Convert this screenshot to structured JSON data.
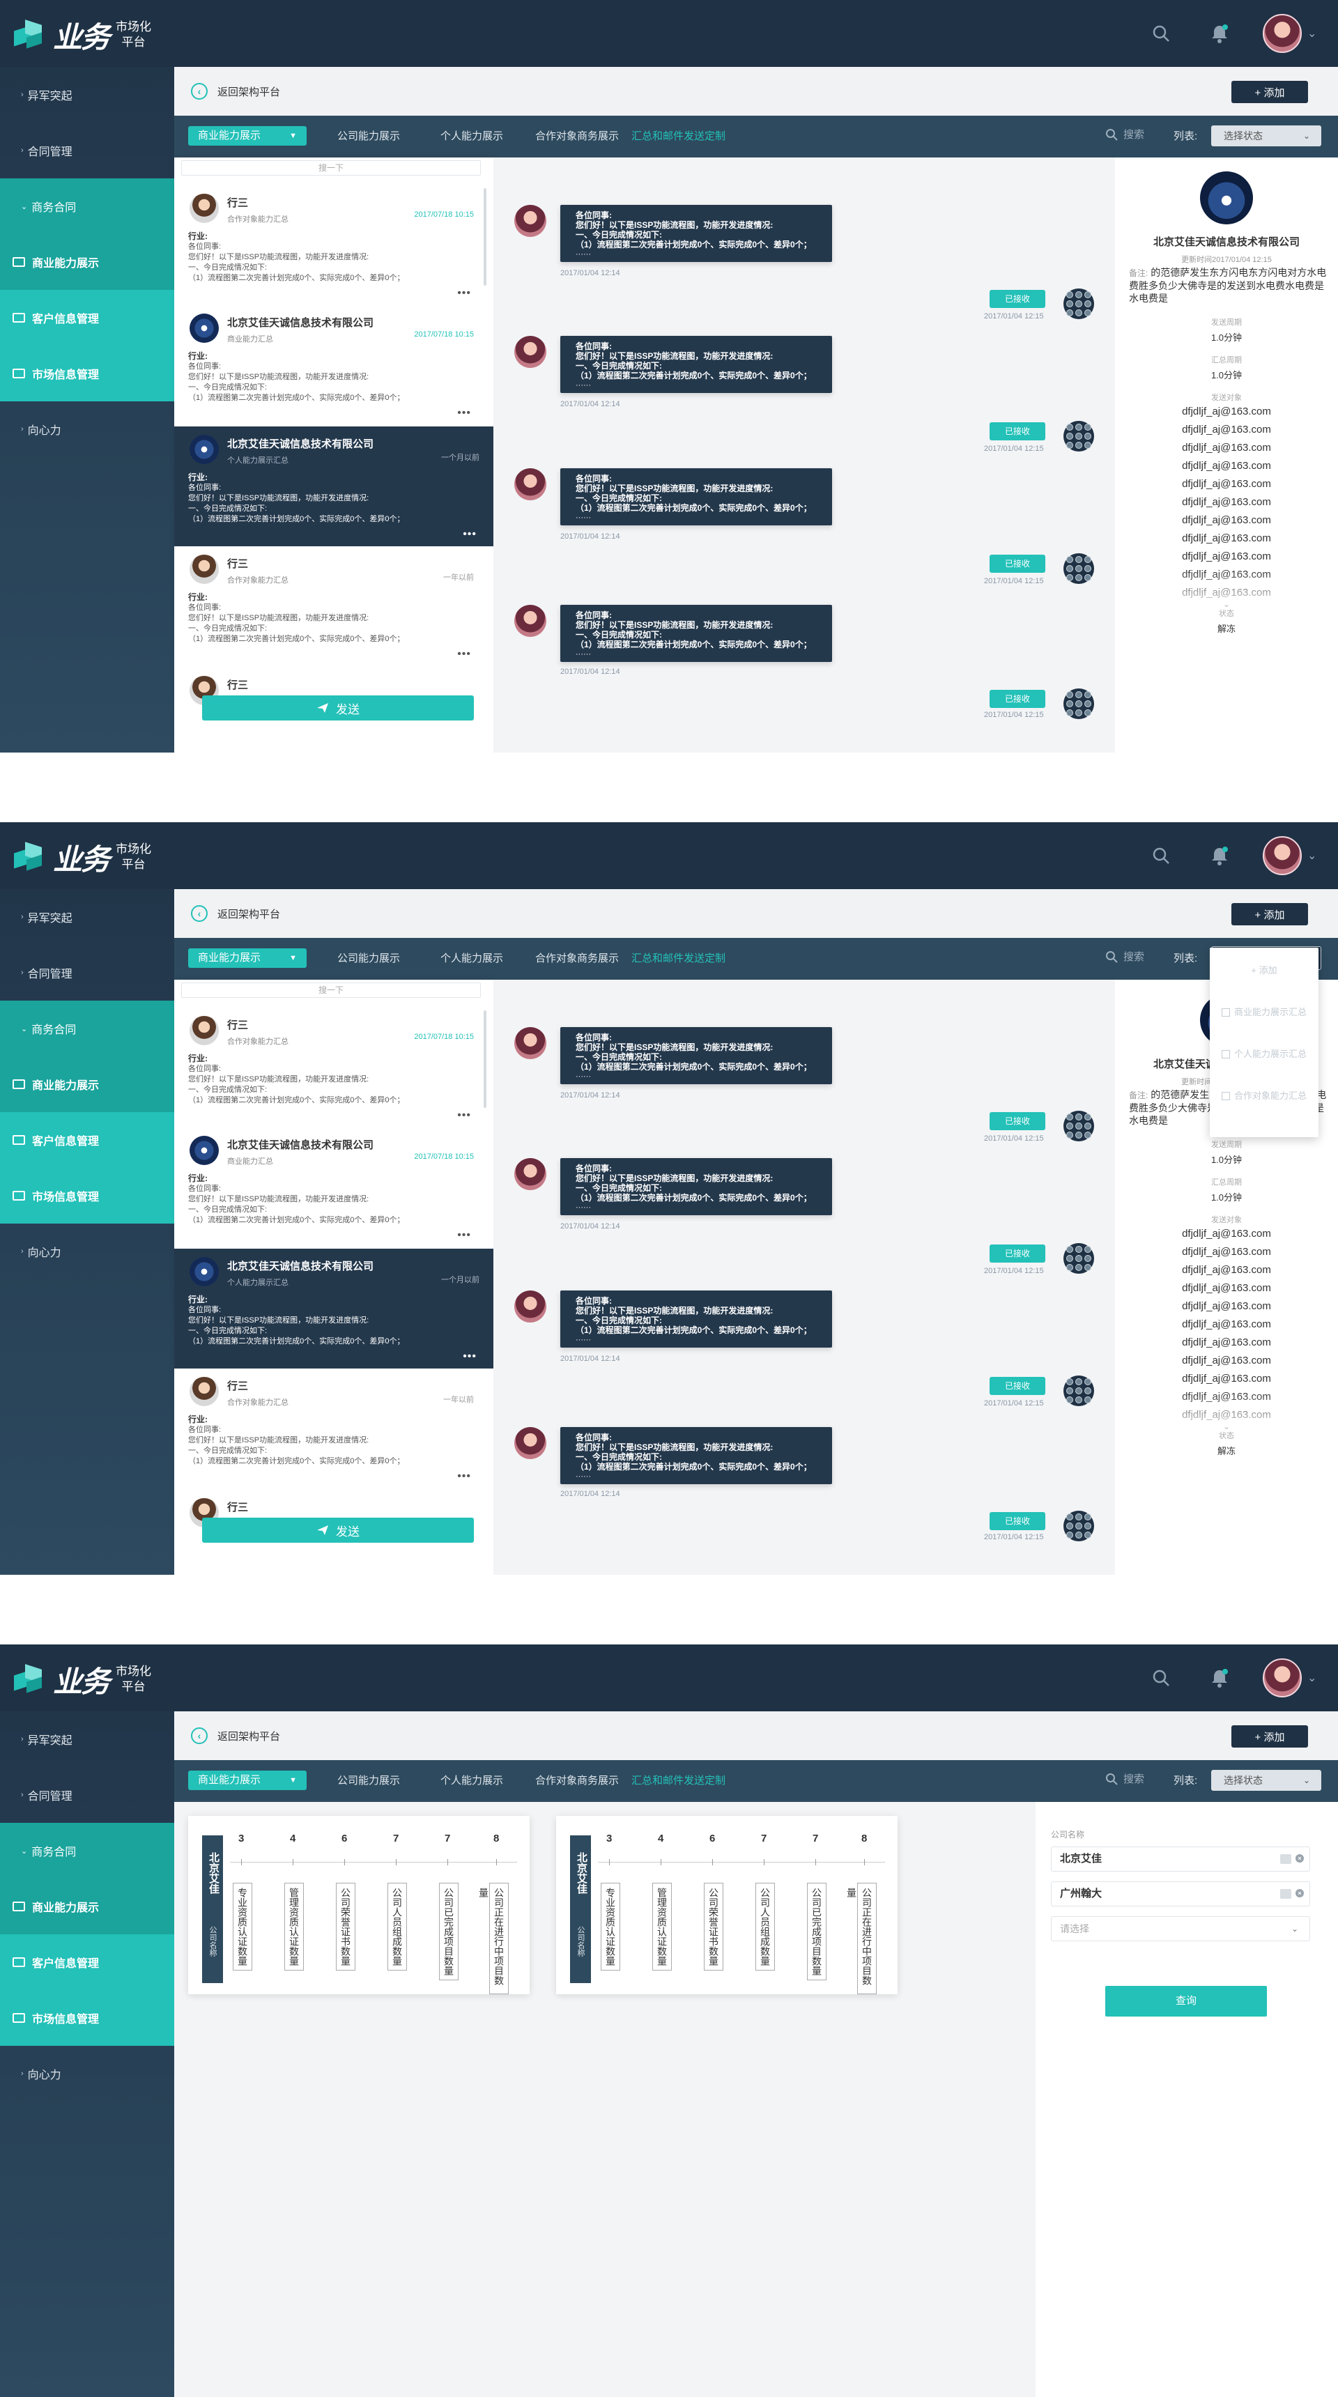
{
  "app": {
    "logo_main": "业务",
    "logo_sub_1": "市场化",
    "logo_sub_2": "平台"
  },
  "topbar": {
    "search_icon": "search-icon",
    "bell_icon": "bell-icon",
    "avatar_caret": "⌄"
  },
  "sidebar": {
    "items": [
      {
        "label": "异军突起"
      },
      {
        "label": "合同管理"
      },
      {
        "label": "商务合同"
      },
      {
        "label": "商业能力展示"
      },
      {
        "label": "客户信息管理"
      },
      {
        "label": "市场信息管理"
      },
      {
        "label": "向心力"
      }
    ]
  },
  "header": {
    "back_label": "返回架构平台",
    "add_label": "+ 添加"
  },
  "tabs": {
    "selected": "商业能力展示",
    "items": [
      "公司能力展示",
      "个人能力展示",
      "合作对象商务展示",
      "汇总和邮件发送定制"
    ],
    "search_label": "搜索",
    "list_label": "列表:",
    "select_label": "选择状态"
  },
  "list": {
    "search_placeholder": "搜一下",
    "send_label": "发送",
    "more": "•••",
    "cards": [
      {
        "name": "行三",
        "sub": "合作对象能力汇总",
        "time": "2017/07/18 10:15",
        "l1": "行业:",
        "l2": "各位同事:",
        "l3": "您们好！以下是ISSP功能流程图，功能开发进度情况:",
        "l4": "一、今日完成情况如下:",
        "l5": "（1）流程图第二次完善计划完成0个、实际完成0个、差异0个；"
      },
      {
        "name": "北京艾佳天诚信息技术有限公司",
        "sub": "商业能力汇总",
        "time": "2017/07/18 10:15",
        "l1": "行业:",
        "l2": "各位同事:",
        "l3": "您们好！以下是ISSP功能流程图，功能开发进度情况:",
        "l4": "一、今日完成情况如下:",
        "l5": "（1）流程图第二次完善计划完成0个、实际完成0个、差异0个；"
      },
      {
        "name": "北京艾佳天诚信息技术有限公司",
        "sub": "个人能力展示汇总",
        "time": "一个月以前",
        "l1": "行业:",
        "l2": "各位同事:",
        "l3": "您们好！以下是ISSP功能流程图，功能开发进度情况:",
        "l4": "一、今日完成情况如下:",
        "l5": "（1）流程图第二次完善计划完成0个、实际完成0个、差异0个；"
      },
      {
        "name": "行三",
        "sub": "合作对象能力汇总",
        "time": "一年以前",
        "l1": "行业:",
        "l2": "各位同事:",
        "l3": "您们好！以下是ISSP功能流程图，功能开发进度情况:",
        "l4": "一、今日完成情况如下:",
        "l5": "（1）流程图第二次完善计划完成0个、实际完成0个、差异0个；"
      },
      {
        "name": "行三",
        "sub": "",
        "time": "",
        "l1": "",
        "l2": "",
        "l3": "",
        "l4": "",
        "l5": ""
      }
    ]
  },
  "chat": {
    "messages": [
      {
        "l1": "各位同事:",
        "l2": "您们好！以下是ISSP功能流程图，功能开发进度情况:",
        "l3": "一、今日完成情况如下:",
        "l4": "（1）流程图第二次完善计划完成0个、实际完成0个、差异0个；",
        "time": "2017/01/04 12:14",
        "recv": "已接收",
        "rtime": "2017/01/04 12:15"
      },
      {
        "l1": "各位同事:",
        "l2": "您们好！以下是ISSP功能流程图，功能开发进度情况:",
        "l3": "一、今日完成情况如下:",
        "l4": "（1）流程图第二次完善计划完成0个、实际完成0个、差异0个；",
        "time": "2017/01/04 12:14",
        "recv": "已接收",
        "rtime": "2017/01/04 12:15"
      },
      {
        "l1": "各位同事:",
        "l2": "您们好！以下是ISSP功能流程图，功能开发进度情况:",
        "l3": "一、今日完成情况如下:",
        "l4": "（1）流程图第二次完善计划完成0个、实际完成0个、差异0个；",
        "time": "2017/01/04 12:14",
        "recv": "已接收",
        "rtime": "2017/01/04 12:15"
      },
      {
        "l1": "各位同事:",
        "l2": "您们好！以下是ISSP功能流程图，功能开发进度情况:",
        "l3": "一、今日完成情况如下:",
        "l4": "（1）流程图第二次完善计划完成0个、实际完成0个、差异0个；",
        "time": "2017/01/04 12:14",
        "recv": "已接收",
        "rtime": "2017/01/04 12:15"
      }
    ],
    "dots": "······"
  },
  "detail": {
    "name": "北京艾佳天诚信息技术有限公司",
    "updated": "更新时间2017/01/04 12:15",
    "note_label": "备注:",
    "note": "的范德萨发生东方闪电东方闪电对方水电费胜多负少大佛寺是的发送到水电费水电费是水电费是",
    "send_cycle_label": "发送周期",
    "send_cycle": "1.0分钟",
    "summary_cycle_label": "汇总周期",
    "summary_cycle": "1.0分钟",
    "targets_label": "发送对象",
    "email": "dfjdljf_aj@163.com",
    "status_label": "状态",
    "status": "解冻"
  },
  "dropdown": {
    "add": "+ 添加",
    "items": [
      "商业能力展示汇总",
      "个人能力展示汇总",
      "合作对象能力汇总"
    ]
  },
  "org": {
    "cards": [
      {
        "name": "北京艾佳",
        "sub": "公司名称"
      },
      {
        "name": "北京艾佳",
        "sub": "公司名称"
      }
    ],
    "nums": [
      "3",
      "4",
      "6",
      "7",
      "7",
      "8"
    ],
    "labels": [
      "专业资质认证数量",
      "管理资质认证数量",
      "公司荣誉证书数量",
      "公司人员组成数量",
      "公司已完成项目数量",
      "公司正在进行中项目数量"
    ]
  },
  "filter": {
    "label": "公司名称",
    "values": [
      "北京艾佳",
      "广州翰大"
    ],
    "placeholder": "请选择",
    "query": "查询"
  },
  "colors": {
    "accent": "#23c1b8",
    "navy": "#1f3144",
    "slate": "#2e4a5e"
  }
}
